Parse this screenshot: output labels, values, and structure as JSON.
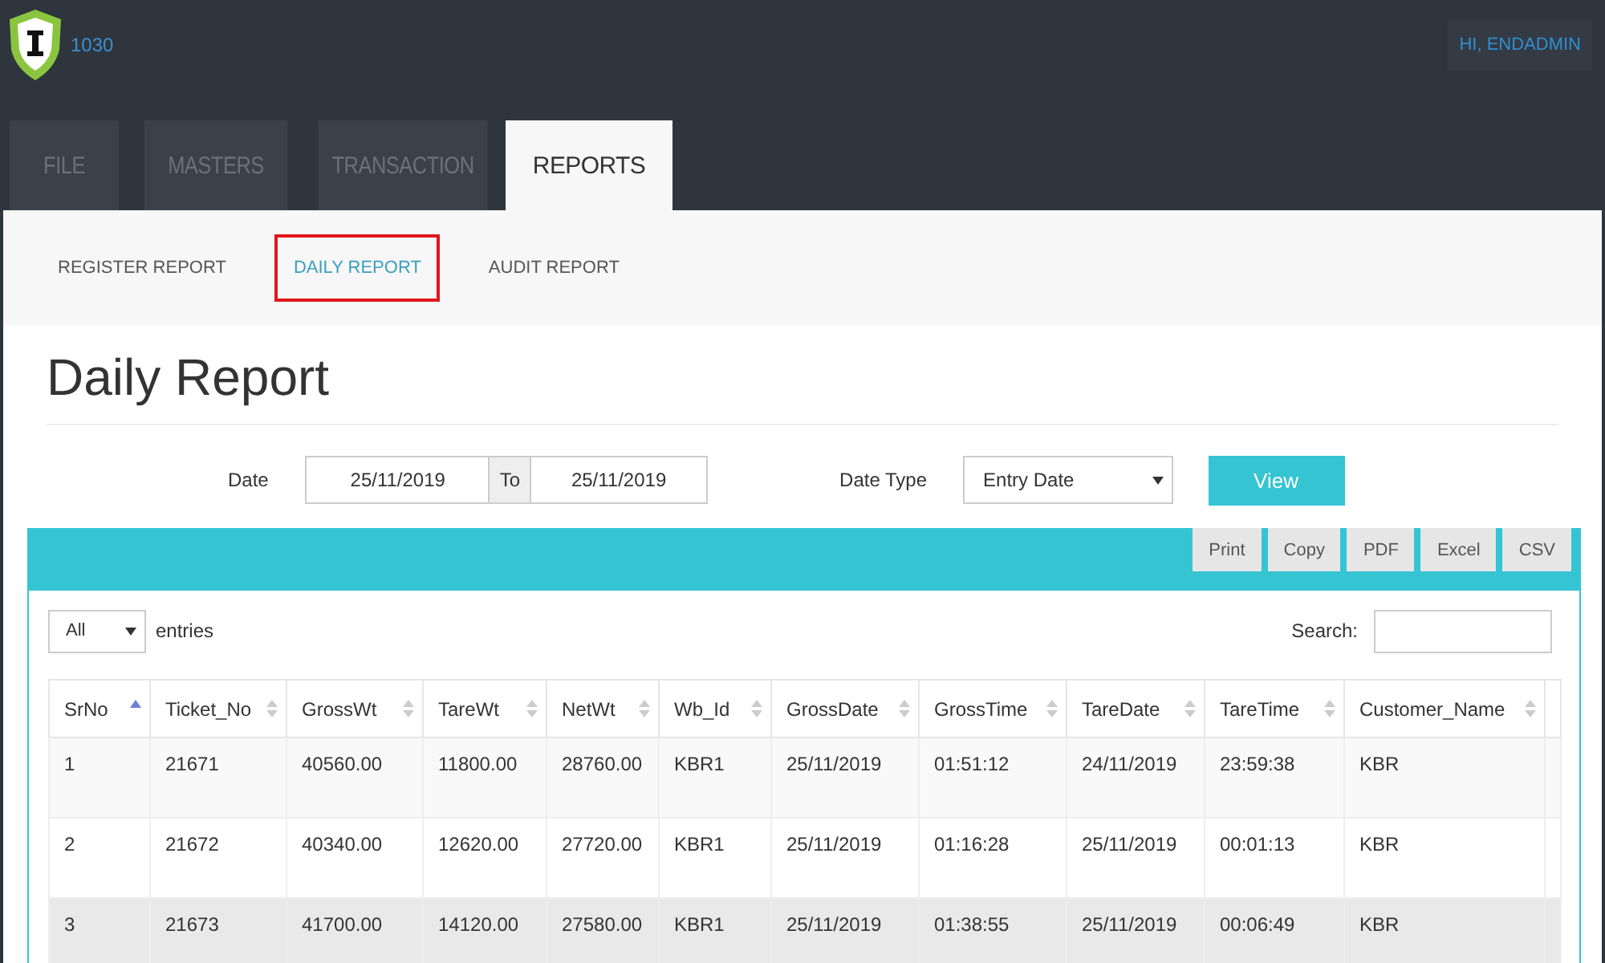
{
  "header": {
    "brand": "1030",
    "user": "HI, ENDADMIN"
  },
  "main_tabs": [
    {
      "label": "FILE",
      "selected": false
    },
    {
      "label": "MASTERS",
      "selected": false
    },
    {
      "label": "TRANSACTION",
      "selected": false
    },
    {
      "label": "REPORTS",
      "selected": true
    }
  ],
  "sub_tabs": [
    {
      "label": "REGISTER REPORT",
      "selected": false
    },
    {
      "label": "DAILY REPORT",
      "selected": true
    },
    {
      "label": "AUDIT REPORT",
      "selected": false
    }
  ],
  "page_title": "Daily Report",
  "filter": {
    "date_label": "Date",
    "from": "25/11/2019",
    "to_label": "To",
    "to": "25/11/2019",
    "date_type_label": "Date Type",
    "date_type": "Entry Date",
    "view_button": "View"
  },
  "export_buttons": [
    "Print",
    "Copy",
    "PDF",
    "Excel",
    "CSV"
  ],
  "length": {
    "value": "All",
    "label": "entries"
  },
  "search": {
    "label": "Search:"
  },
  "table": {
    "columns": [
      {
        "label": "SrNo",
        "sorted": true
      },
      {
        "label": "Ticket_No",
        "sorted": false
      },
      {
        "label": "GrossWt",
        "sorted": false
      },
      {
        "label": "TareWt",
        "sorted": false
      },
      {
        "label": "NetWt",
        "sorted": false
      },
      {
        "label": "Wb_Id",
        "sorted": false
      },
      {
        "label": "GrossDate",
        "sorted": false
      },
      {
        "label": "GrossTime",
        "sorted": false
      },
      {
        "label": "TareDate",
        "sorted": false
      },
      {
        "label": "TareTime",
        "sorted": false
      },
      {
        "label": "Customer_Name",
        "sorted": false
      }
    ],
    "rows": [
      {
        "highlighted": false,
        "cells": [
          "1",
          "21671",
          "40560.00",
          "11800.00",
          "28760.00",
          "KBR1",
          "25/11/2019",
          "01:51:12",
          "24/11/2019",
          "23:59:38",
          "KBR"
        ]
      },
      {
        "highlighted": false,
        "cells": [
          "2",
          "21672",
          "40340.00",
          "12620.00",
          "27720.00",
          "KBR1",
          "25/11/2019",
          "01:16:28",
          "25/11/2019",
          "00:01:13",
          "KBR"
        ]
      },
      {
        "highlighted": true,
        "cells": [
          "3",
          "21673",
          "41700.00",
          "14120.00",
          "27580.00",
          "KBR1",
          "25/11/2019",
          "01:38:55",
          "25/11/2019",
          "00:06:49",
          "KBR"
        ]
      }
    ]
  }
}
